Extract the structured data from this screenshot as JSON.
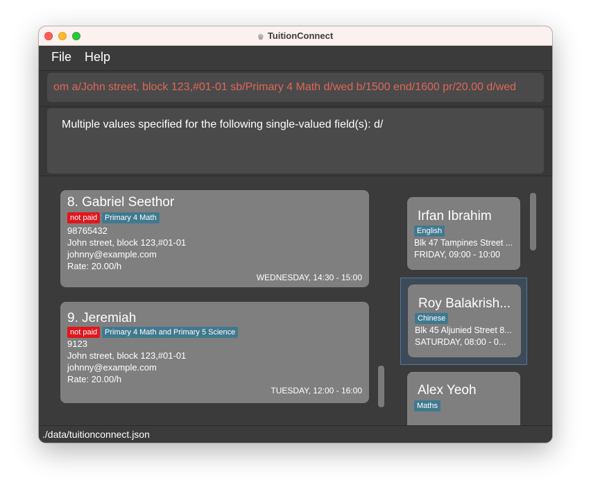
{
  "window": {
    "title": "TuitionConnect"
  },
  "menu": {
    "file": "File",
    "help": "Help"
  },
  "command": {
    "value": "om a/John street, block 123,#01-01 sb/Primary 4 Math d/wed b/1500 end/1600 pr/20.00 d/wed"
  },
  "result": {
    "text": "Multiple values specified for the following single-valued field(s): d/"
  },
  "students": [
    {
      "name": "8.  Gabriel Seethor",
      "paid": "not paid",
      "subjects": "Primary 4 Math",
      "phone": "98765432",
      "address": "John street, block 123,#01-01",
      "email": "johnny@example.com",
      "rate": "Rate: 20.00/h",
      "slot": "WEDNESDAY, 14:30 - 15:00"
    },
    {
      "name": "9.  Jeremiah",
      "paid": "not paid",
      "subjects": "Primary 4 Math and Primary 5 Science",
      "phone": "9123",
      "address": "John street, block 123,#01-01",
      "email": "johnny@example.com",
      "rate": "Rate: 20.00/h",
      "slot": "TUESDAY, 12:00 - 16:00"
    }
  ],
  "schedule": [
    {
      "name": "Irfan Ibrahim",
      "subject": "English",
      "address": "Blk 47 Tampines Street ...",
      "slot": "FRIDAY, 09:00 - 10:00"
    },
    {
      "name": "Roy Balakrish...",
      "subject": "Chinese",
      "address": "Blk 45 Aljunied Street 8...",
      "slot": "SATURDAY, 08:00 - 0..."
    },
    {
      "name": "Alex Yeoh",
      "subject": "Maths"
    }
  ],
  "status": {
    "path": "./data/tuitionconnect.json"
  },
  "colors": {
    "not_paid": "#e0161d",
    "subject_tag": "#40798f",
    "command_text": "#e0665a",
    "selected_border": "#4f7aa1"
  }
}
